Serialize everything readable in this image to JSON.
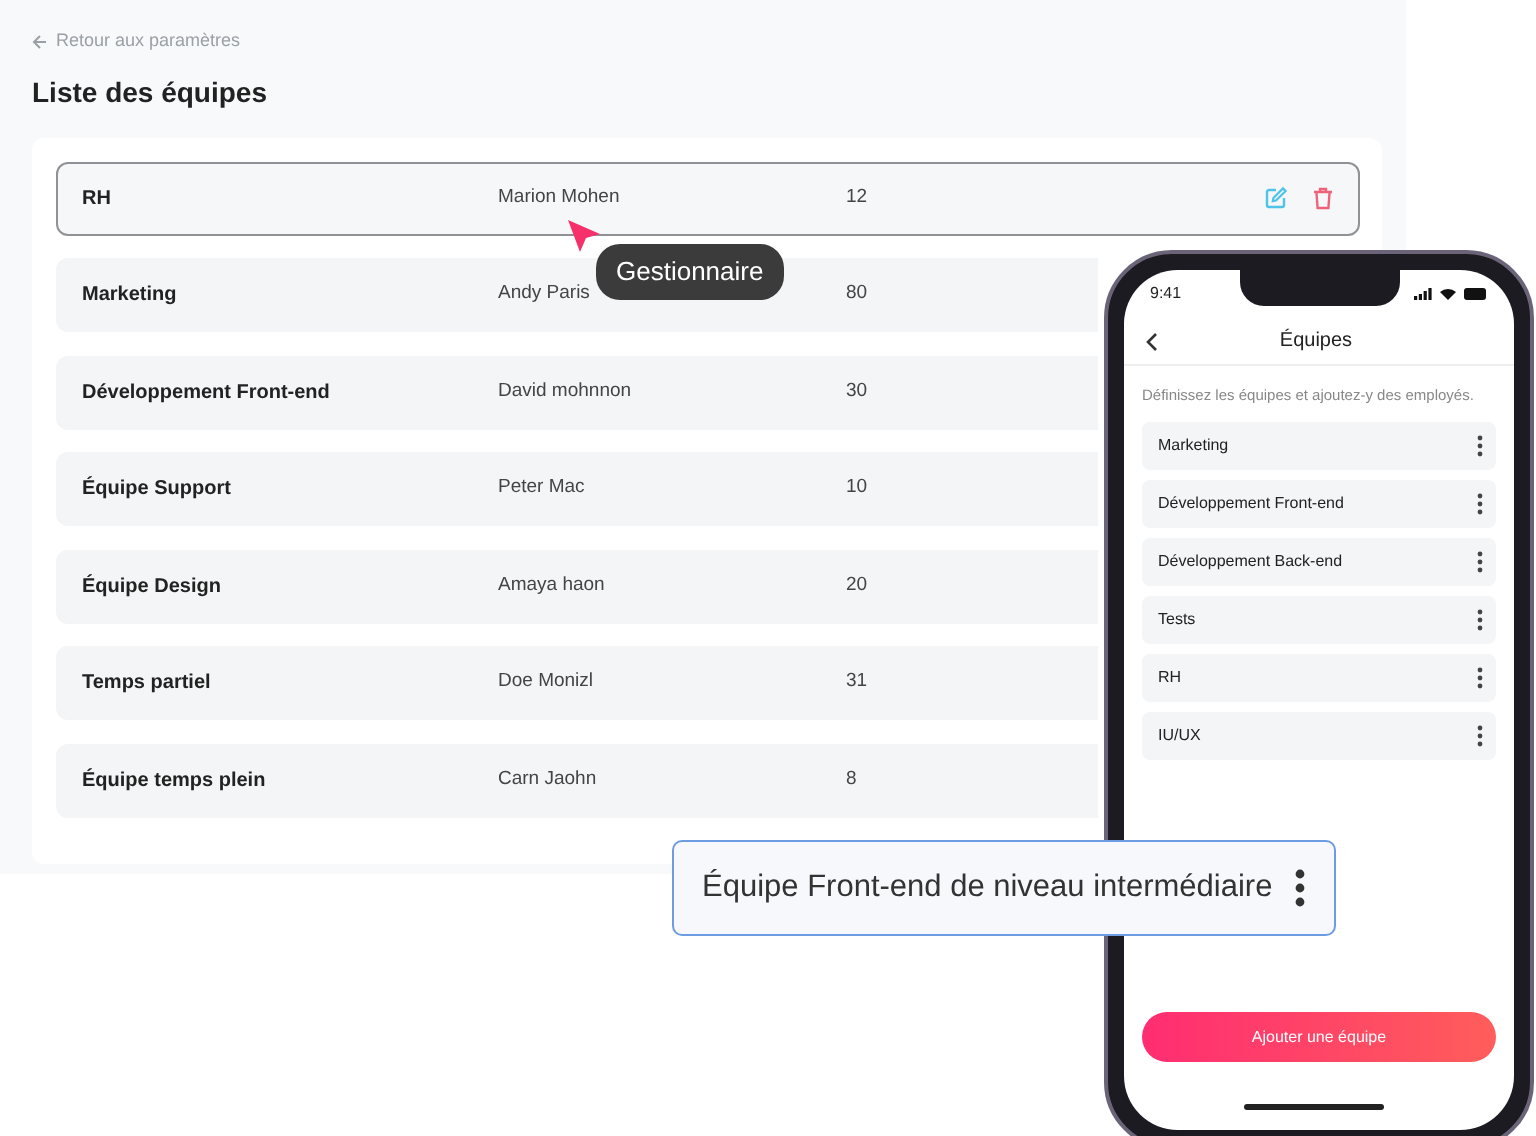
{
  "back_link": "Retour aux paramètres",
  "title": "Liste des équipes",
  "teams": [
    {
      "name": "RH",
      "manager": "Marion Mohen",
      "count": "12",
      "selected": true
    },
    {
      "name": "Marketing",
      "manager": "Andy Paris",
      "count": "80",
      "selected": false
    },
    {
      "name": "Développement Front-end",
      "manager": "David mohnnon",
      "count": "30",
      "selected": false
    },
    {
      "name": "Équipe Support",
      "manager": "Peter Mac",
      "count": "10",
      "selected": false
    },
    {
      "name": "Équipe Design",
      "manager": "Amaya haon",
      "count": "20",
      "selected": false
    },
    {
      "name": "Temps partiel",
      "manager": "Doe Monizl",
      "count": "31",
      "selected": false
    },
    {
      "name": "Équipe temps plein",
      "manager": "Carn Jaohn",
      "count": "8",
      "selected": false
    }
  ],
  "tooltip": "Gestionnaire",
  "phone": {
    "time": "9:41",
    "title": "Équipes",
    "subtitle": "Définissez les équipes et ajoutez-y des employés.",
    "items": [
      "Marketing",
      "Développement Front-end",
      "Développement Back-end",
      "Tests",
      "RH",
      "IU/UX"
    ],
    "button": "Ajouter une équipe"
  },
  "floating_card": {
    "label": "Équipe Front-end de niveau intermédiaire"
  }
}
